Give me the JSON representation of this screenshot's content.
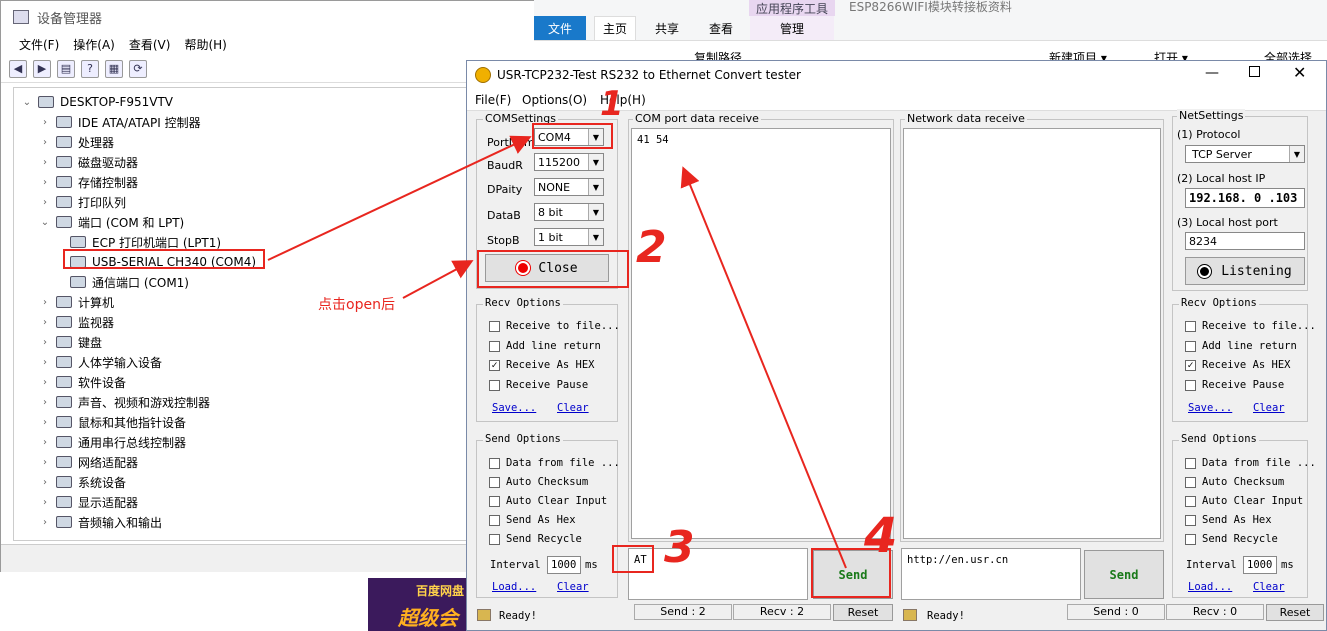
{
  "device_manager": {
    "title": "设备管理器",
    "menu": [
      "文件(F)",
      "操作(A)",
      "查看(V)",
      "帮助(H)"
    ],
    "computer": "DESKTOP-F951VTV",
    "tree": [
      {
        "label": "IDE ATA/ATAPI 控制器",
        "expanded": false
      },
      {
        "label": "处理器",
        "expanded": false
      },
      {
        "label": "磁盘驱动器",
        "expanded": false
      },
      {
        "label": "存储控制器",
        "expanded": false
      },
      {
        "label": "打印队列",
        "expanded": false
      },
      {
        "label": "端口 (COM 和 LPT)",
        "expanded": true
      },
      {
        "label": "ECP 打印机端口 (LPT1)",
        "child": true
      },
      {
        "label": "USB-SERIAL CH340 (COM4)",
        "child": true
      },
      {
        "label": "通信端口 (COM1)",
        "child": true
      },
      {
        "label": "计算机",
        "expanded": false
      },
      {
        "label": "监视器",
        "expanded": false
      },
      {
        "label": "键盘",
        "expanded": false
      },
      {
        "label": "人体学输入设备",
        "expanded": false
      },
      {
        "label": "软件设备",
        "expanded": false
      },
      {
        "label": "声音、视频和游戏控制器",
        "expanded": false
      },
      {
        "label": "鼠标和其他指针设备",
        "expanded": false
      },
      {
        "label": "通用串行总线控制器",
        "expanded": false
      },
      {
        "label": "网络适配器",
        "expanded": false
      },
      {
        "label": "系统设备",
        "expanded": false
      },
      {
        "label": "显示适配器",
        "expanded": false
      },
      {
        "label": "音频输入和输出",
        "expanded": false
      }
    ]
  },
  "explorer": {
    "context_tab": "应用程序工具",
    "window_title": "ESP8266WIFI模块转接板资料",
    "tabs": [
      "文件",
      "主页",
      "共享",
      "查看",
      "管理"
    ],
    "ribbon_items": [
      "复制路径",
      "新建项目 ▾",
      "打开 ▾",
      "全部选择"
    ]
  },
  "usr": {
    "title": "USR-TCP232-Test  RS232 to Ethernet Convert tester",
    "menu": [
      "File(F)",
      "Options(O)",
      "Help(H)"
    ],
    "com_settings": {
      "label": "COMSettings",
      "fields": [
        {
          "label": "PortNum",
          "value": "COM4"
        },
        {
          "label": "BaudR",
          "value": "115200"
        },
        {
          "label": "DPaity",
          "value": "NONE"
        },
        {
          "label": "DataB",
          "value": "8 bit"
        },
        {
          "label": "StopB",
          "value": "1 bit"
        }
      ],
      "button": "Close"
    },
    "recv_options": {
      "label": "Recv Options",
      "items": [
        {
          "label": "Receive to file...",
          "checked": false
        },
        {
          "label": "Add line return",
          "checked": false
        },
        {
          "label": "Receive As HEX",
          "checked": true
        },
        {
          "label": "Receive Pause",
          "checked": false
        }
      ],
      "save": "Save...",
      "clear": "Clear"
    },
    "send_options": {
      "label": "Send Options",
      "items": [
        {
          "label": "Data from file ...",
          "checked": false
        },
        {
          "label": "Auto Checksum",
          "checked": false
        },
        {
          "label": "Auto Clear Input",
          "checked": false
        },
        {
          "label": "Send As Hex",
          "checked": false
        },
        {
          "label": "Send Recycle",
          "checked": false
        }
      ],
      "interval_label": "Interval",
      "interval_value": "1000",
      "interval_unit": "ms",
      "load": "Load...",
      "clear": "Clear"
    },
    "com_receive": {
      "label": "COM port data receive",
      "content": "41 54"
    },
    "net_receive": {
      "label": "Network data receive",
      "content": ""
    },
    "com_send_input": "AT",
    "net_send_input": "http://en.usr.cn",
    "send_label": "Send",
    "net_settings": {
      "label": "NetSettings",
      "protocol_label": "(1) Protocol",
      "protocol": "TCP Server",
      "ip_label": "(2) Local host IP",
      "ip": "192.168. 0 .103",
      "port_label": "(3) Local host port",
      "port": "8234",
      "button": "Listening"
    },
    "status_left": {
      "ready": "Ready!",
      "send": "Send : 2",
      "recv": "Recv : 2",
      "reset": "Reset"
    },
    "status_right": {
      "ready": "Ready!",
      "send": "Send : 0",
      "recv": "Recv : 0",
      "reset": "Reset"
    }
  },
  "annotations": {
    "note": "点击open后",
    "steps": [
      "1",
      "2",
      "3",
      "4"
    ]
  },
  "banner": {
    "line1": "百度网盘",
    "line2": "超级会"
  }
}
